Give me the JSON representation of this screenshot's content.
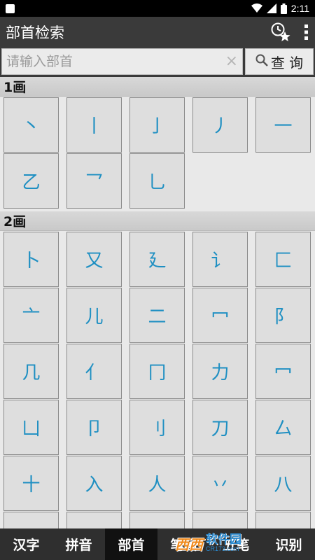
{
  "status_bar": {
    "time": "2:11"
  },
  "app_bar": {
    "title": "部首检索",
    "history_icon": "clock-star-icon",
    "menu_icon": "overflow-menu-icon"
  },
  "search": {
    "placeholder": "请输入部首",
    "value": "",
    "clear_icon": "×",
    "query_label": "查 询"
  },
  "sections": [
    {
      "title": "1画",
      "radicals": [
        "丶",
        "丨",
        "亅",
        "丿",
        "一",
        "乙",
        "乛",
        "乚"
      ]
    },
    {
      "title": "2画",
      "radicals": [
        "卜",
        "又",
        "廴",
        "讠",
        "匚",
        "亠",
        "儿",
        "二",
        "冖",
        "阝",
        "几",
        "亻",
        "冂",
        "力",
        "冖",
        "凵",
        "卩",
        "刂",
        "刀",
        "厶",
        "十",
        "入",
        "人",
        "丷",
        "八",
        "",
        "",
        "",
        "",
        ""
      ]
    }
  ],
  "bottom_tabs": [
    "汉字",
    "拼音",
    "部首",
    "笔画",
    "五笔",
    "识别"
  ],
  "active_tab_index": 2,
  "watermark": {
    "brand": "西西",
    "name": "软件园",
    "url": "CR173.com"
  },
  "colors": {
    "accent": "#1e8fc2",
    "app_bar": "#3a3a3a",
    "tab_bar": "#2f2f2f"
  }
}
